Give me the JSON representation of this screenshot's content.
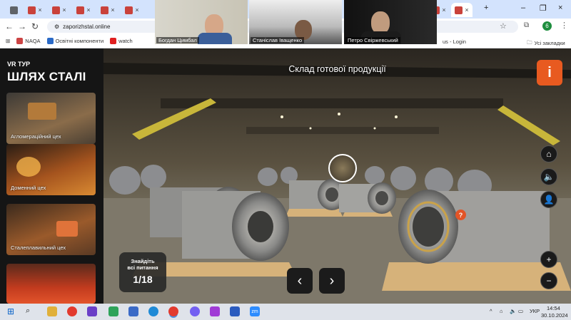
{
  "browser": {
    "url": "zaporizhstal.online",
    "bookmarks": [
      "NAQA",
      "Освітні компоненти",
      "watch"
    ],
    "bookmarks_right": [
      "us - Login"
    ],
    "all_bookmarks": "Усі закладки",
    "profile_initial": "6"
  },
  "video_call": {
    "participants": [
      "Богдан Цимбал",
      "Станіслав Іващенко",
      "Петро Свіржевський"
    ]
  },
  "sidebar": {
    "tag": "VR ТУР",
    "title": "ШЛЯХ СТАЛІ",
    "cards": [
      {
        "label": "Агломераційний цех"
      },
      {
        "label": "Доменний цех"
      },
      {
        "label": "Сталеплавильний цех"
      },
      {
        "label": ""
      }
    ]
  },
  "scene": {
    "title": "Склад готової продукції",
    "info_label": "i",
    "quiz_line1": "Знайдіть",
    "quiz_line2": "всі питання",
    "quiz_progress": "1/18",
    "question_mark": "?",
    "prev_arrow": "‹",
    "next_arrow": "›",
    "zoom_in": "+",
    "zoom_out": "−"
  },
  "taskbar": {
    "language": "УКР",
    "time": "14:54",
    "date": "30.10.2024"
  },
  "colors": {
    "accent": "#e85a20",
    "tabstrip": "#d3e3fd"
  }
}
